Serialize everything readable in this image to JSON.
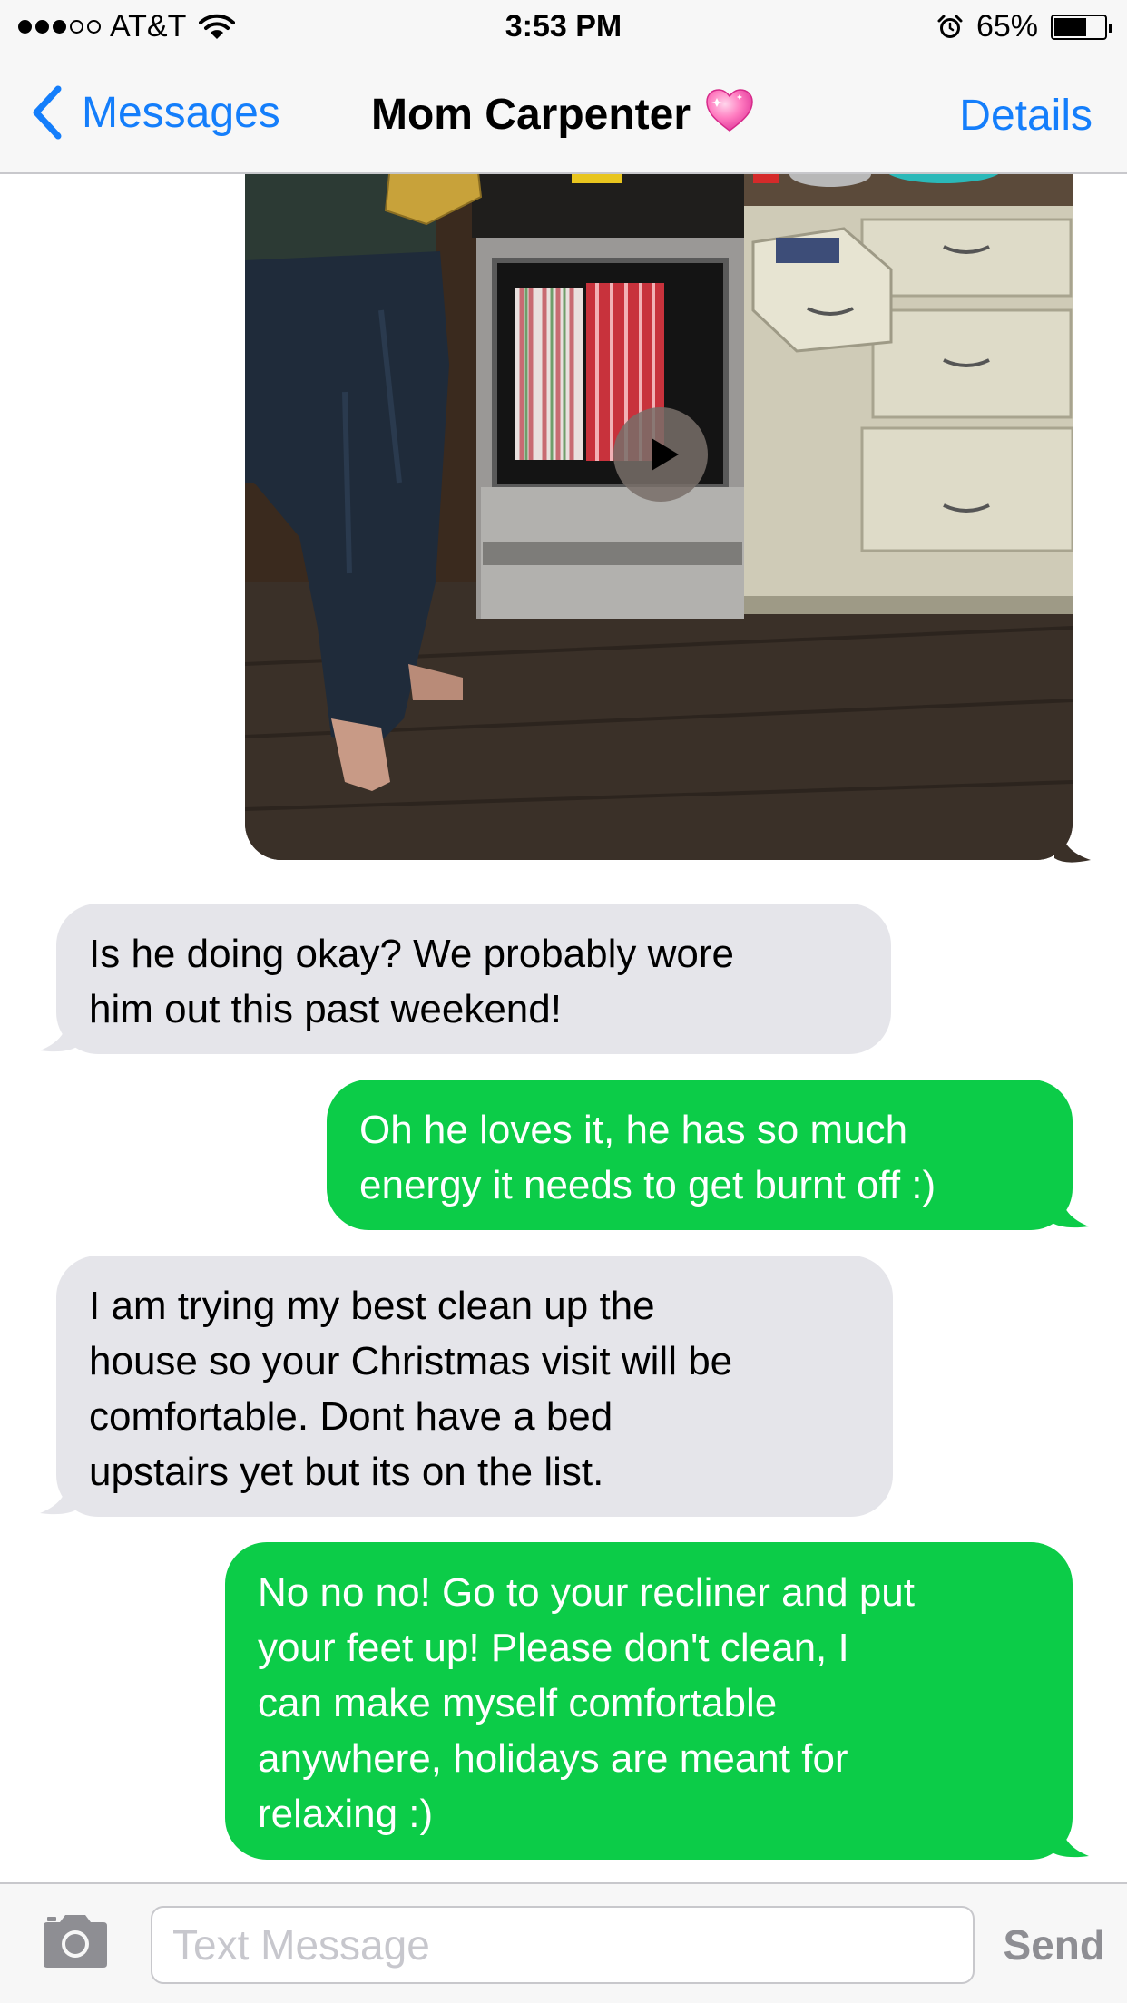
{
  "status_bar": {
    "signal_dots_filled": 3,
    "signal_dots_total": 5,
    "carrier": "AT&T",
    "time": "3:53 PM",
    "battery_text": "65%",
    "battery_level": 0.65,
    "icons": [
      "wifi-icon",
      "alarm-icon",
      "battery-icon"
    ]
  },
  "nav": {
    "back_label": "Messages",
    "title": "Mom Carpenter",
    "title_emoji_icon": "sparkling-heart-icon",
    "details_label": "Details"
  },
  "conversation": {
    "video_message": {
      "direction": "outgoing",
      "icon": "play-icon"
    },
    "messages": [
      {
        "direction": "incoming",
        "text_lines": [
          "Is he doing okay? We probably wore",
          "him out this past weekend!"
        ]
      },
      {
        "direction": "outgoing",
        "text_lines": [
          "Oh he loves it, he has so much",
          "energy it needs to get burnt off :)"
        ]
      },
      {
        "direction": "incoming",
        "text_lines": [
          "I am trying my best clean up the",
          "house so your Christmas visit will be",
          "comfortable. Dont have a bed",
          "upstairs yet but its on the list."
        ]
      },
      {
        "direction": "outgoing",
        "text_lines": [
          "No no no! Go to your recliner and put",
          "your feet up! Please don't clean, I",
          "can make myself comfortable",
          "anywhere, holidays are meant for",
          "relaxing :)"
        ]
      }
    ]
  },
  "input_bar": {
    "camera_icon": "camera-icon",
    "placeholder": "Text Message",
    "value": "",
    "send_label": "Send"
  },
  "colors": {
    "ios_blue": "#147efb",
    "outgoing_bubble": "#0ccc48",
    "incoming_bubble": "#e5e5ea",
    "send_disabled": "#8e8e93"
  }
}
